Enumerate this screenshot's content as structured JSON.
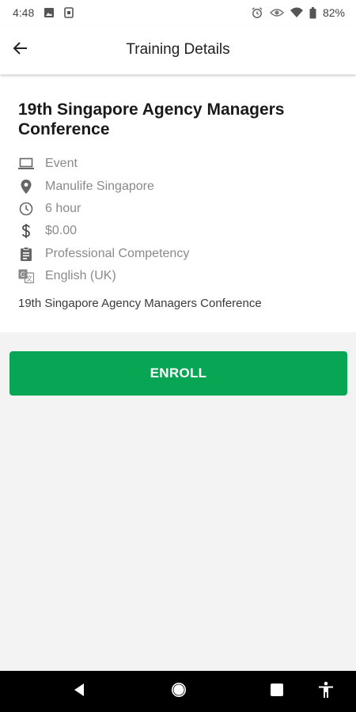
{
  "status_bar": {
    "time": "4:48",
    "battery": "82%",
    "icons": [
      "image-icon",
      "sim-icon",
      "alarm-icon",
      "eye-icon",
      "wifi-icon",
      "battery-icon"
    ]
  },
  "app_bar": {
    "title": "Training Details",
    "back_icon": "arrow-left-icon"
  },
  "course": {
    "title": "19th Singapore Agency Managers Conference",
    "details": [
      {
        "icon": "laptop-icon",
        "text": "Event"
      },
      {
        "icon": "location-pin-icon",
        "text": "Manulife Singapore"
      },
      {
        "icon": "clock-icon",
        "text": "6 hour"
      },
      {
        "icon": "dollar-icon",
        "text": "$0.00"
      },
      {
        "icon": "clipboard-icon",
        "text": "Professional Competency"
      },
      {
        "icon": "translate-icon",
        "text": "English (UK)"
      }
    ],
    "description": "19th Singapore Agency Managers Conference"
  },
  "enroll": {
    "label": "ENROLL",
    "color": "#08a654"
  },
  "nav_bar": {
    "icons": [
      "back-triangle-icon",
      "home-circle-icon",
      "recents-square-icon",
      "accessibility-icon"
    ]
  }
}
